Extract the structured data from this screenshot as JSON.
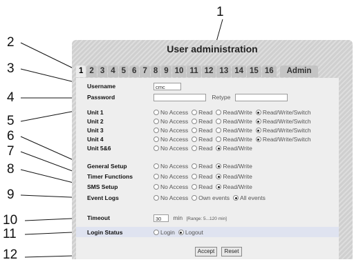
{
  "window": {
    "title": "User administration"
  },
  "tabs": [
    "1",
    "2",
    "3",
    "4",
    "5",
    "6",
    "7",
    "8",
    "9",
    "10",
    "11",
    "12",
    "13",
    "14",
    "15",
    "16",
    "Admin"
  ],
  "fields": {
    "username": {
      "label": "Username",
      "value": "cmc"
    },
    "password": {
      "label": "Password",
      "value": "",
      "retype_label": "Retype",
      "retype_value": ""
    },
    "timeout": {
      "label": "Timeout",
      "value": "30",
      "unit": "min",
      "range_hint": "[Range: 5...120 min]"
    },
    "login_status": {
      "label": "Login Status",
      "options": [
        "Login",
        "Logout"
      ],
      "selected": "Logout"
    }
  },
  "permissions": [
    {
      "label": "Unit 1",
      "options": [
        "No Access",
        "Read",
        "Read/Write",
        "Read/Write/Switch"
      ],
      "selected": "Read/Write/Switch"
    },
    {
      "label": "Unit 2",
      "options": [
        "No Access",
        "Read",
        "Read/Write",
        "Read/Write/Switch"
      ],
      "selected": "Read/Write/Switch"
    },
    {
      "label": "Unit 3",
      "options": [
        "No Access",
        "Read",
        "Read/Write",
        "Read/Write/Switch"
      ],
      "selected": "Read/Write/Switch"
    },
    {
      "label": "Unit 4",
      "options": [
        "No Access",
        "Read",
        "Read/Write",
        "Read/Write/Switch"
      ],
      "selected": "Read/Write/Switch"
    },
    {
      "label": "Unit 5&6",
      "options": [
        "No Access",
        "Read",
        "Read/Write"
      ],
      "selected": "Read/Write"
    },
    {
      "label": "General Setup",
      "options": [
        "No Access",
        "Read",
        "Read/Write"
      ],
      "selected": "Read/Write"
    },
    {
      "label": "Timer Functions",
      "options": [
        "No Access",
        "Read",
        "Read/Write"
      ],
      "selected": "Read/Write"
    },
    {
      "label": "SMS Setup",
      "options": [
        "No Access",
        "Read",
        "Read/Write"
      ],
      "selected": "Read/Write"
    },
    {
      "label": "Event Logs",
      "options": [
        "No Access",
        "Own events",
        "All events"
      ],
      "selected": "All events"
    }
  ],
  "buttons": {
    "accept": "Accept",
    "reset": "Reset"
  },
  "callouts": [
    "1",
    "2",
    "3",
    "4",
    "5",
    "6",
    "7",
    "8",
    "9",
    "10",
    "11",
    "12"
  ]
}
